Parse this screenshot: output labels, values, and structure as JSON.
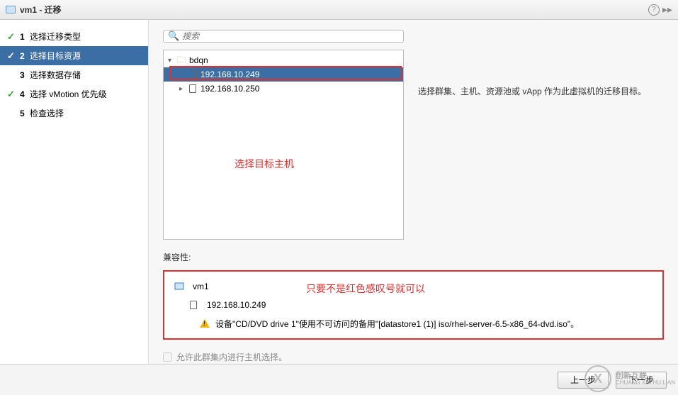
{
  "window": {
    "title": "vm1 - 迁移"
  },
  "sidebar": {
    "steps": [
      {
        "num": "1",
        "label": "选择迁移类型",
        "done": true
      },
      {
        "num": "2",
        "label": "选择目标资源",
        "active": true,
        "done": true
      },
      {
        "num": "3",
        "label": "选择数据存储"
      },
      {
        "num": "4",
        "label": "选择 vMotion 优先级",
        "done": true
      },
      {
        "num": "5",
        "label": "检查选择"
      }
    ]
  },
  "search": {
    "placeholder": "搜索"
  },
  "tree": {
    "root": "bdqn",
    "children": [
      {
        "label": "192.168.10.249",
        "selected": true
      },
      {
        "label": "192.168.10.250"
      }
    ]
  },
  "side_text": "选择群集、主机、资源池或 vApp 作为此虚拟机的迁移目标。",
  "annotation1": "选择目标主机",
  "compat": {
    "title": "兼容性:",
    "vm": "vm1",
    "host": "192.168.10.249",
    "warning": "设备\"CD/DVD drive 1\"使用不可访问的备用\"[datastore1 (1)] iso/rhel-server-6.5-x86_64-dvd.iso\"。"
  },
  "annotation2": "只要不是红色感叹号就可以",
  "cluster_checkbox": "允许此群集内进行主机选择。",
  "footer": {
    "back": "上一步",
    "next": "下一步"
  },
  "logo": {
    "symbol": "X",
    "label": "创新互联",
    "sub": "CHUANG XIN HU LIAN"
  }
}
